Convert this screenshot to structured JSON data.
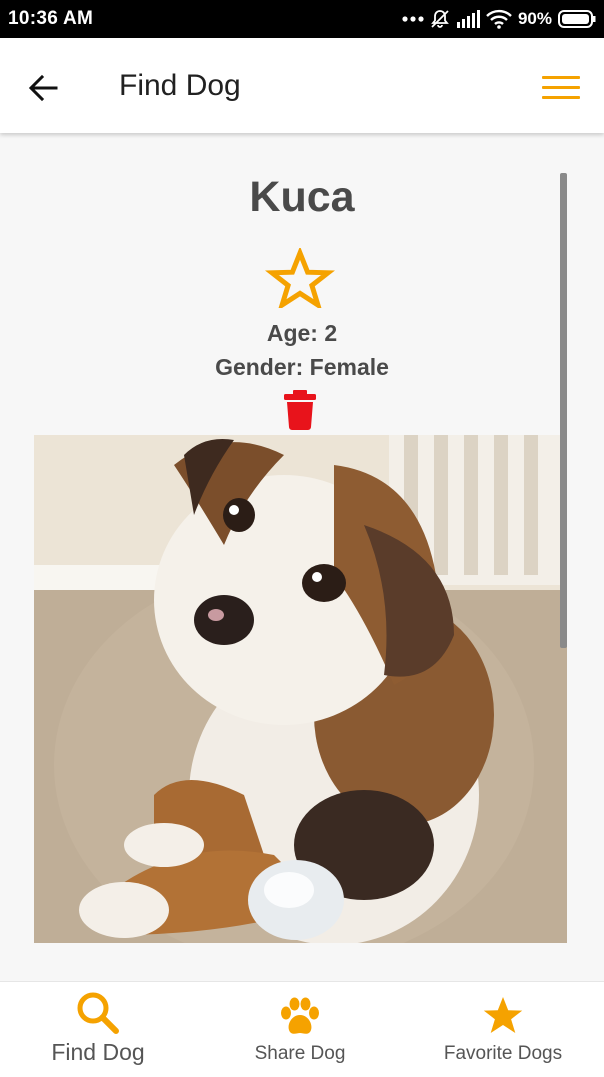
{
  "status_bar": {
    "time": "10:36 AM",
    "battery": "90%"
  },
  "app_bar": {
    "title": "Find Dog",
    "back_icon": "arrow-left-icon",
    "menu_icon": "hamburger-menu-icon"
  },
  "dog": {
    "name": "Kuca",
    "age": "Age: 2",
    "gender": "Gender: Female",
    "favorite_icon": "star-outline-icon",
    "delete_icon": "trash-icon",
    "photo_icon": "dog-photo"
  },
  "bottom_nav": {
    "items": [
      {
        "label": "Find Dog",
        "icon": "search-icon"
      },
      {
        "label": "Share Dog",
        "icon": "paw-icon"
      },
      {
        "label": "Favorite Dogs",
        "icon": "star-icon"
      }
    ]
  },
  "colors": {
    "accent": "#f5a200",
    "delete": "#e8131b",
    "text": "#4a4a4a",
    "status_bar": "#000000"
  }
}
